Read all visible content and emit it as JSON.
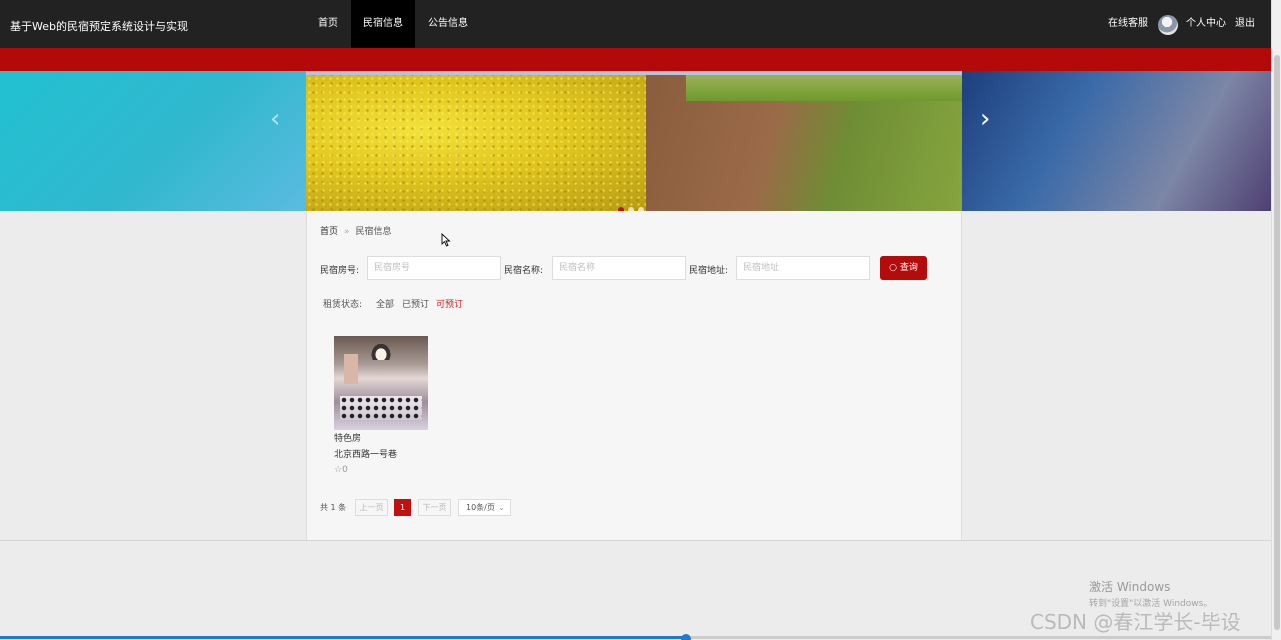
{
  "header": {
    "brand": "基于Web的民宿预定系统设计与实现",
    "nav": [
      {
        "label": "首页"
      },
      {
        "label": "民宿信息",
        "active": true
      },
      {
        "label": "公告信息"
      }
    ],
    "service": "在线客服",
    "personal": "个人中心",
    "logout": "退出"
  },
  "carousel": {
    "prev_icon": "‹",
    "next_icon": "›",
    "active_index": 0,
    "slide_count": 3
  },
  "breadcrumb": {
    "home": "首页",
    "separator": "»",
    "current": "民宿信息"
  },
  "search": {
    "room_label": "民宿房号:",
    "room_placeholder": "民宿房号",
    "name_label": "民宿名称:",
    "name_placeholder": "民宿名称",
    "address_label": "民宿地址:",
    "address_placeholder": "民宿地址",
    "button": "查询"
  },
  "filter": {
    "label": "租赁状态:",
    "options": [
      "全部",
      "已预订",
      "可预订"
    ],
    "active": "可预订"
  },
  "listing": {
    "items": [
      {
        "name": "特色房",
        "address": "北京西路一号巷",
        "favorites": "0"
      }
    ]
  },
  "pagination": {
    "total": "共 1 条",
    "prev": "上一页",
    "current": "1",
    "next": "下一页",
    "page_size": "10条/页"
  },
  "watermark": {
    "activate_title": "激活 Windows",
    "activate_sub": "转到\"设置\"以激活 Windows。",
    "csdn": "CSDN @春江学长-毕设"
  },
  "colors": {
    "accent": "#b40909",
    "nav_bg": "#222222",
    "active_filter": "#d02020"
  },
  "video_progress": 0.54
}
